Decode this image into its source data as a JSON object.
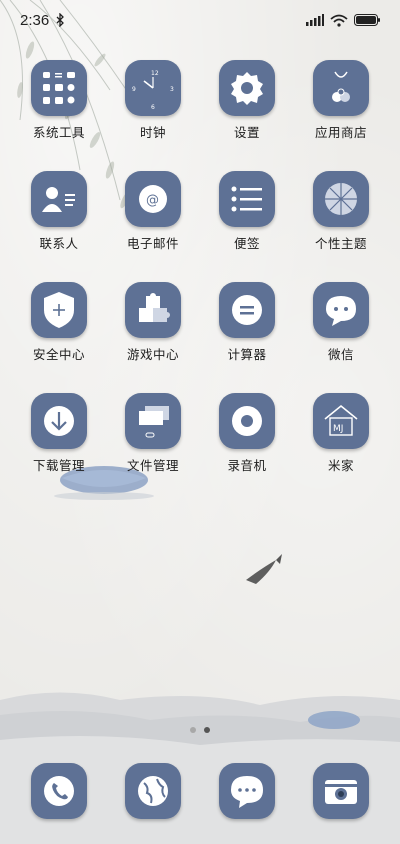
{
  "status_bar": {
    "time": "2:36",
    "bluetooth_icon": "bluetooth-icon",
    "signal_icon": "signal-icon",
    "wifi_icon": "wifi-icon",
    "battery_icon": "battery-icon"
  },
  "apps": [
    {
      "label": "系统工具",
      "icon": "tools-grid-icon"
    },
    {
      "label": "时钟",
      "icon": "clock-icon"
    },
    {
      "label": "设置",
      "icon": "gear-icon"
    },
    {
      "label": "应用商店",
      "icon": "shopping-bag-icon"
    },
    {
      "label": "联系人",
      "icon": "contact-card-icon"
    },
    {
      "label": "电子邮件",
      "icon": "email-at-icon"
    },
    {
      "label": "便签",
      "icon": "notes-list-icon"
    },
    {
      "label": "个性主题",
      "icon": "umbrella-icon"
    },
    {
      "label": "安全中心",
      "icon": "shield-icon"
    },
    {
      "label": "游戏中心",
      "icon": "puzzle-icon"
    },
    {
      "label": "计算器",
      "icon": "calculator-equals-icon"
    },
    {
      "label": "微信",
      "icon": "chat-bubble-icon"
    },
    {
      "label": "下载管理",
      "icon": "download-arrow-icon"
    },
    {
      "label": "文件管理",
      "icon": "folder-icon"
    },
    {
      "label": "录音机",
      "icon": "record-icon"
    },
    {
      "label": "米家",
      "icon": "mijia-house-icon"
    }
  ],
  "dock": [
    {
      "icon": "phone-icon"
    },
    {
      "icon": "globe-browser-icon"
    },
    {
      "icon": "message-bubble-icon"
    },
    {
      "icon": "camera-icon"
    }
  ],
  "page_indicator": {
    "pages": 2,
    "current": 2
  },
  "colors": {
    "icon_bg": "#5e7195",
    "icon_fg": "#ffffff"
  }
}
